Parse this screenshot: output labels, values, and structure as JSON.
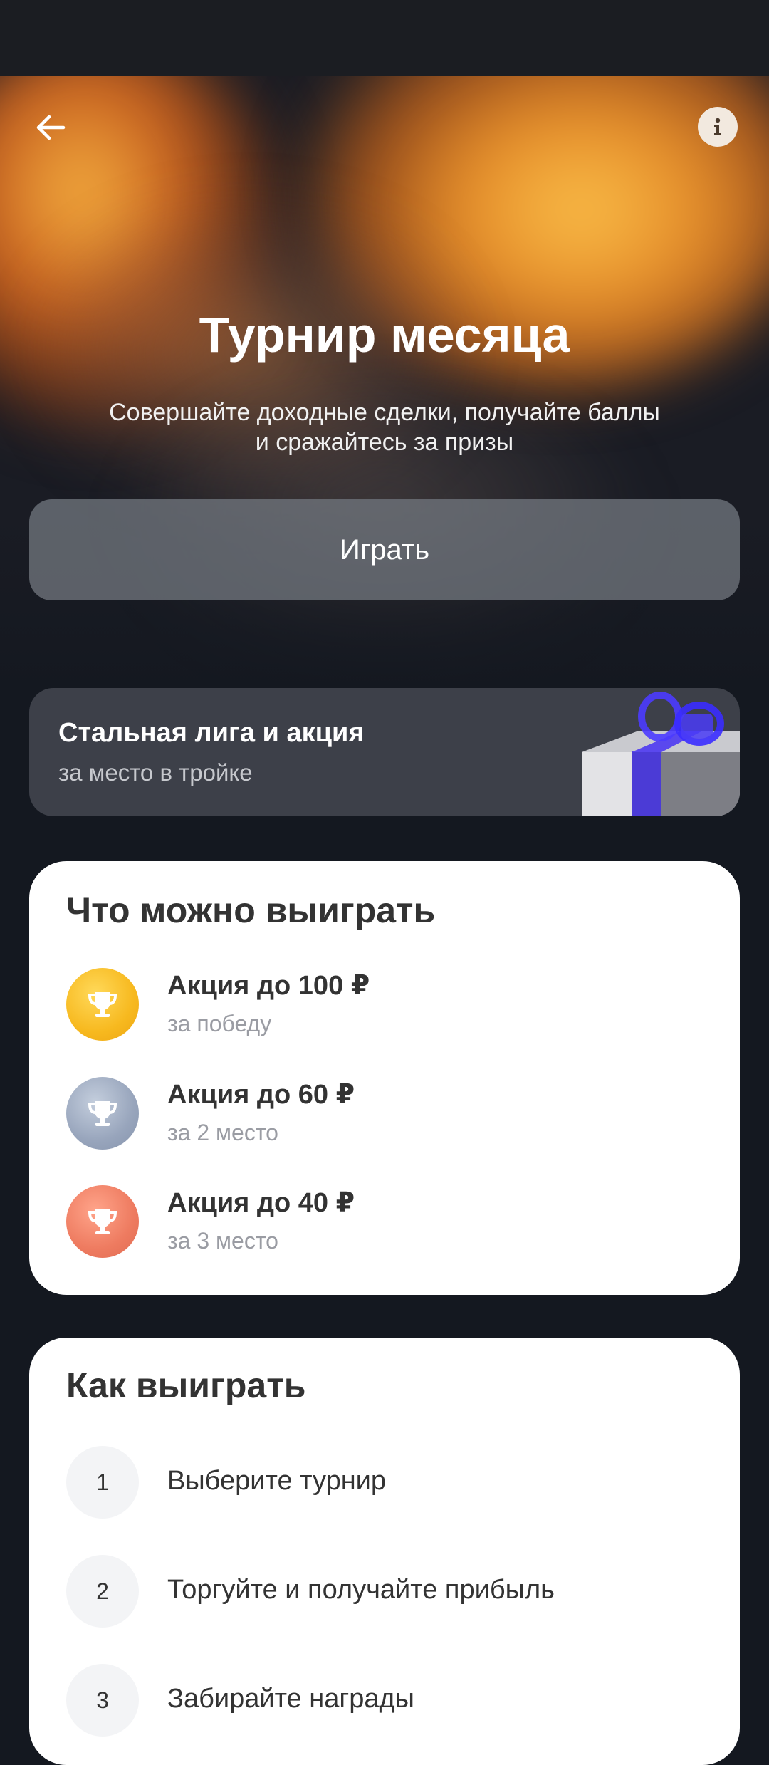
{
  "hero": {
    "title": "Турнир месяца",
    "subtitle_line1": "Совершайте доходные сделки, получайте баллы",
    "subtitle_line2": "и сражайтесь за призы",
    "back_icon": "arrow-left-icon",
    "info_icon": "info-icon",
    "play_label": "Играть"
  },
  "league": {
    "title": "Стальная лига и акция",
    "subtitle": "за место в тройке",
    "image": "gift-box-icon"
  },
  "prizes": {
    "title": "Что можно выиграть",
    "items": [
      {
        "title": "Акция до 100 ₽",
        "subtitle": "за победу",
        "medal": "gold",
        "icon": "trophy-icon"
      },
      {
        "title": "Акция до 60 ₽",
        "subtitle": "за 2 место",
        "medal": "silver",
        "icon": "trophy-icon"
      },
      {
        "title": "Акция до 40 ₽",
        "subtitle": "за 3 место",
        "medal": "bronze",
        "icon": "trophy-icon"
      }
    ]
  },
  "howto": {
    "title": "Как выиграть",
    "steps": [
      {
        "number": "1",
        "text": "Выберите турнир"
      },
      {
        "number": "2",
        "text": "Торгуйте и получайте прибыль"
      },
      {
        "number": "3",
        "text": "Забирайте награды"
      }
    ]
  },
  "colors": {
    "background": "#141820",
    "card": "#ffffff",
    "league_card": "#3d4049",
    "gold": "#f7b91f",
    "silver": "#98a5bc",
    "bronze": "#ee7b60"
  }
}
